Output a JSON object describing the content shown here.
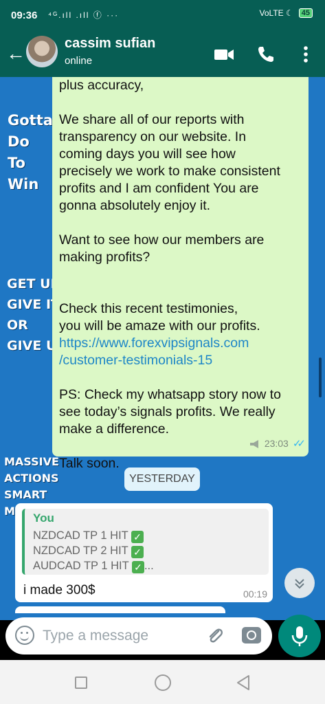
{
  "status_bar": {
    "time": "09:36",
    "left_icons": "⁴ᴳ.ıll .ıll ⓕ ···",
    "right_icons": "VoLTE ☾",
    "battery": "45"
  },
  "header": {
    "contact_name": "cassim sufian",
    "contact_status": "online"
  },
  "background_art": {
    "block1": [
      "Gotta",
      "Do",
      "To",
      "Win"
    ],
    "block2": [
      "GET UP",
      "GIVE IT",
      "OR",
      "GIVE UP"
    ],
    "block3": [
      "MASSIVE",
      "ACTIONS",
      "SMART",
      "M"
    ]
  },
  "messages": {
    "outgoing": {
      "p1": "plus accuracy,",
      "p2": "We share all of our reports with\ntransparency on our website. In\ncoming days you will see how\nprecisely we work to make consistent\nprofits and I am confident You are\ngonna absolutely enjoy it.",
      "p3": "Want to see how our members are\nmaking profits?",
      "p4": "Check this recent testimonies,\nyou will be amaze with our profits.",
      "link_line1": "https://www.forexvipsignals.com",
      "link_line2": "/customer-testimonials-15",
      "p5": "PS: Check my whatsapp story now to\nsee today’s signals profits. We really\nmake a difference.",
      "p6": "Talk soon.",
      "time": "23:03"
    },
    "date_chip": "YESTERDAY",
    "incoming": {
      "quote_author": "You",
      "quote_lines": [
        "NZDCAD TP 1 HIT",
        "NZDCAD TP 2 HIT",
        "AUDCAD TP 1 HIT"
      ],
      "quote_ellipsis": "...",
      "text": "i made 300$",
      "time": "00:19"
    }
  },
  "composer": {
    "placeholder": "Type a message"
  },
  "colors": {
    "header": "#075e54",
    "outgoing_bubble": "#dcf8c6",
    "link": "#1d86c7",
    "mic_button": "#00897b"
  }
}
